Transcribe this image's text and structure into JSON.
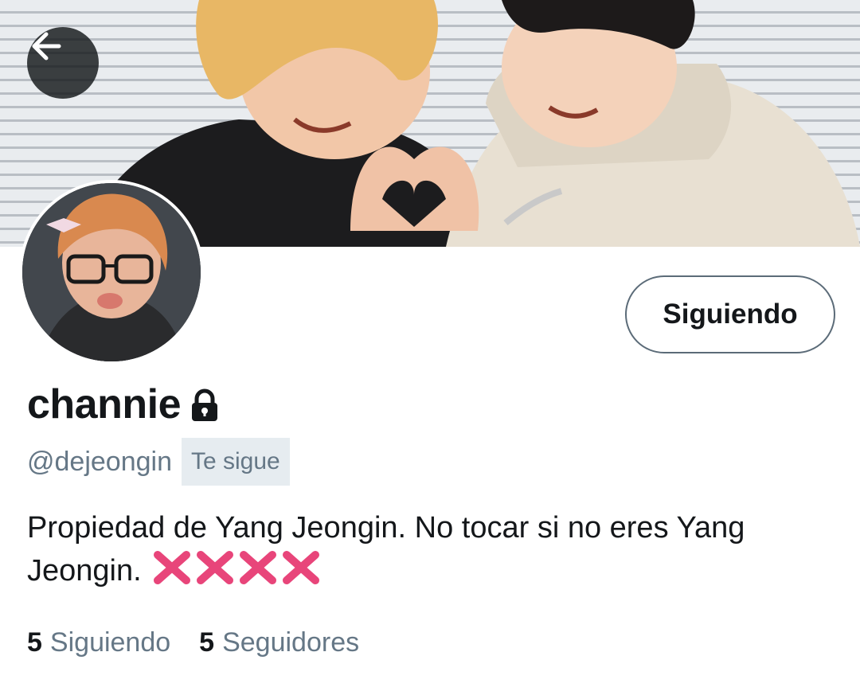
{
  "header": {
    "back_icon": "arrow-left-icon"
  },
  "profile": {
    "display_name": "channie",
    "protected_icon": "lock-icon",
    "handle": "@dejeongin",
    "follows_you_badge": "Te sigue",
    "bio_text": "Propiedad de Yang Jeongin. No tocar si no eres Yang Jeongin.",
    "bio_emoji_icon": "cross-mark-icon",
    "bio_emoji_count": 4
  },
  "actions": {
    "follow_button_label": "Siguiendo"
  },
  "stats": {
    "following_count": "5",
    "following_label": "Siguiendo",
    "followers_count": "5",
    "followers_label": "Seguidores"
  },
  "colors": {
    "secondary_text": "#657786",
    "badge_bg": "#e6ecf0",
    "button_border": "#5b6b78",
    "emoji_cross": "#e8457a"
  }
}
